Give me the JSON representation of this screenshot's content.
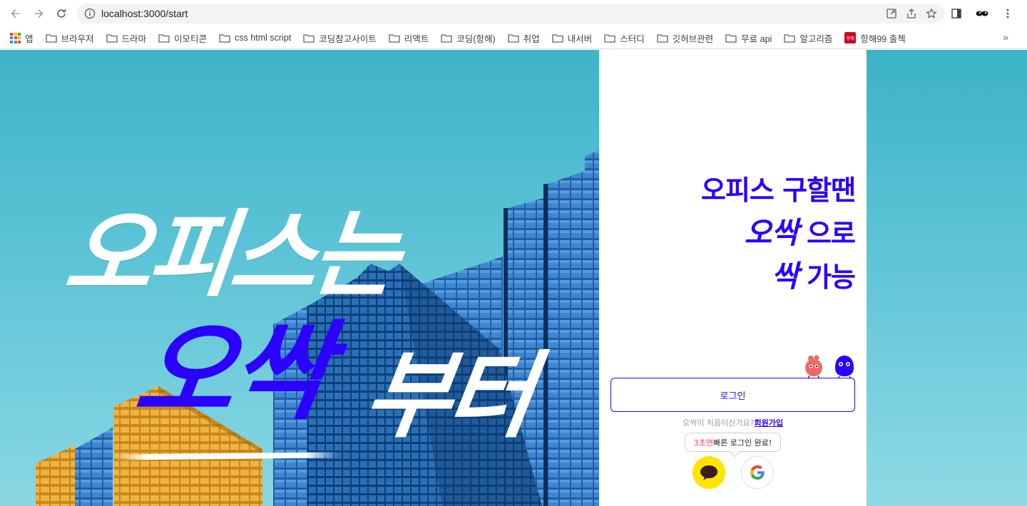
{
  "browser": {
    "url": "localhost:3000/start",
    "bookmarks": [
      {
        "label": "앱",
        "icon": "apps-grid-icon"
      },
      {
        "label": "브라우저",
        "icon": "folder-icon"
      },
      {
        "label": "드라마",
        "icon": "folder-icon"
      },
      {
        "label": "이모티콘",
        "icon": "folder-icon"
      },
      {
        "label": "css html script",
        "icon": "folder-icon"
      },
      {
        "label": "코딩참고사이트",
        "icon": "folder-icon"
      },
      {
        "label": "리액트",
        "icon": "folder-icon"
      },
      {
        "label": "코딩(항해)",
        "icon": "folder-icon"
      },
      {
        "label": "취업",
        "icon": "folder-icon"
      },
      {
        "label": "내서버",
        "icon": "folder-icon"
      },
      {
        "label": "스터디",
        "icon": "folder-icon"
      },
      {
        "label": "깃허브관련",
        "icon": "folder-icon"
      },
      {
        "label": "무료 api",
        "icon": "folder-icon"
      },
      {
        "label": "알고리즘",
        "icon": "folder-icon"
      },
      {
        "label": "항해99 출첵",
        "icon": "hanghae-favicon"
      }
    ],
    "bookmark_favicon_text": "항해",
    "more": "»"
  },
  "hero": {
    "line1": "오피스는",
    "line2_accent": "오싹",
    "line2_rest": "부터"
  },
  "panel": {
    "slogan_line1": "오피스 구할땐",
    "slogan_line2_accent": "오싹",
    "slogan_line2_rest": " 으로",
    "slogan_line3_accent": "싹",
    "slogan_line3_rest": " 가능",
    "login_label": "로그인",
    "signup_question": "오싹이 처음이신가요?",
    "signup_link": "회원가입",
    "bubble_highlight": "3초면",
    "bubble_text": "빠른 로그인 완료!"
  },
  "colors": {
    "brand": "#2b00ff",
    "kakao": "#fee500",
    "sky": "#45b9ce"
  }
}
